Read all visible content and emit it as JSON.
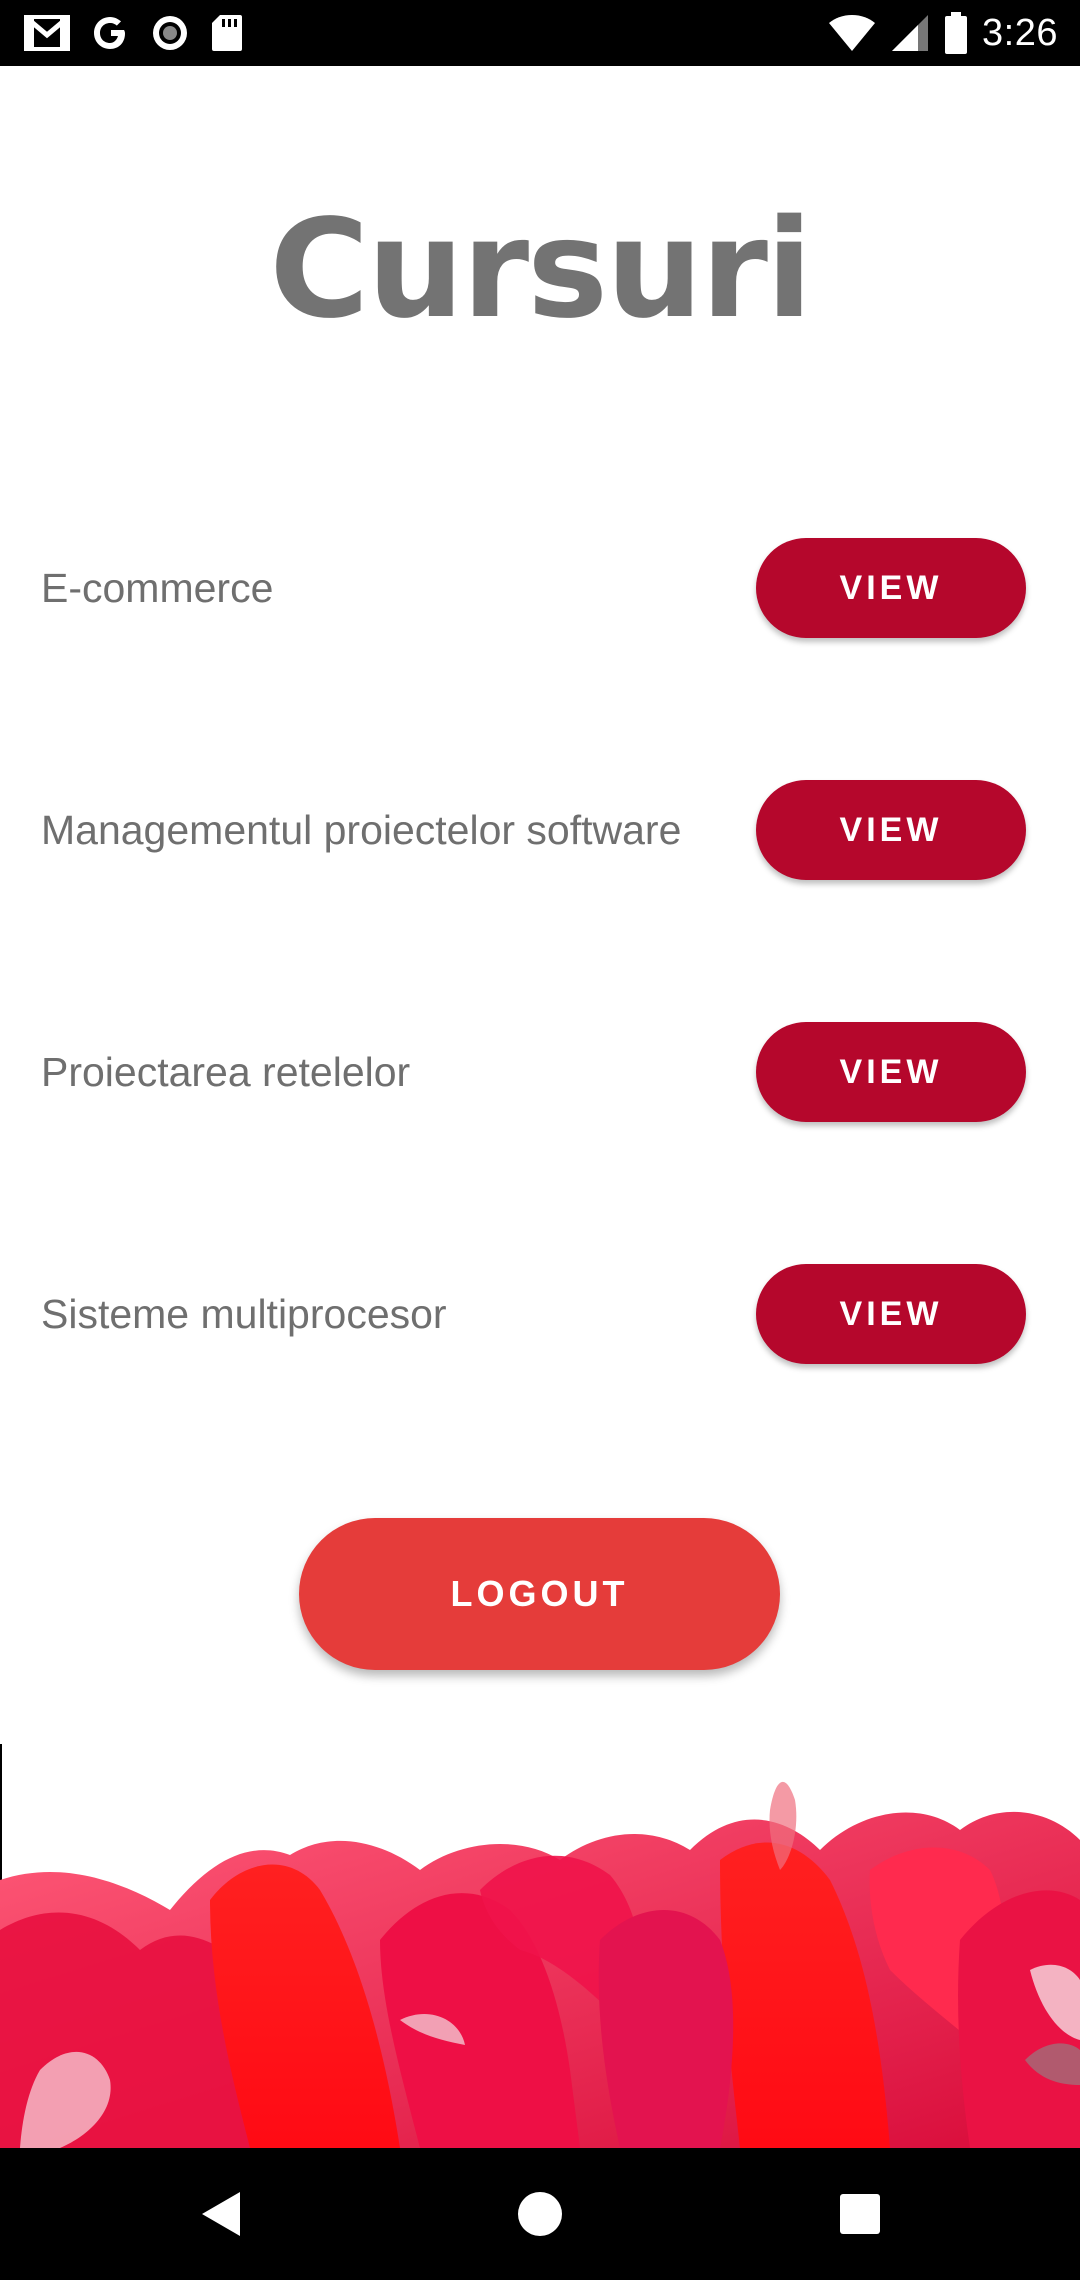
{
  "status_bar": {
    "time": "3:26",
    "left_icons": [
      "gmail-icon",
      "google-icon",
      "record-icon",
      "sd-card-icon"
    ],
    "right_icons": [
      "wifi-icon",
      "cell-signal-icon",
      "battery-icon"
    ]
  },
  "page": {
    "title": "Cursuri"
  },
  "courses": [
    {
      "name": "E-commerce",
      "button_label": "VIEW"
    },
    {
      "name": "Managementul proiectelor software",
      "button_label": "VIEW"
    },
    {
      "name": "Proiectarea retelelor",
      "button_label": "VIEW"
    },
    {
      "name": "Sisteme multiprocesor",
      "button_label": "VIEW"
    }
  ],
  "logout": {
    "label": "LOGOUT"
  },
  "navigation": {
    "buttons": [
      "back-icon",
      "home-icon",
      "recents-icon"
    ]
  },
  "colors": {
    "view_button": "#b5072c",
    "logout_button": "#e53c3a",
    "title_text": "#737373",
    "course_text": "#6f6f6f",
    "paint_primary": "#e8103f",
    "paint_bright": "#ff1a1a"
  }
}
